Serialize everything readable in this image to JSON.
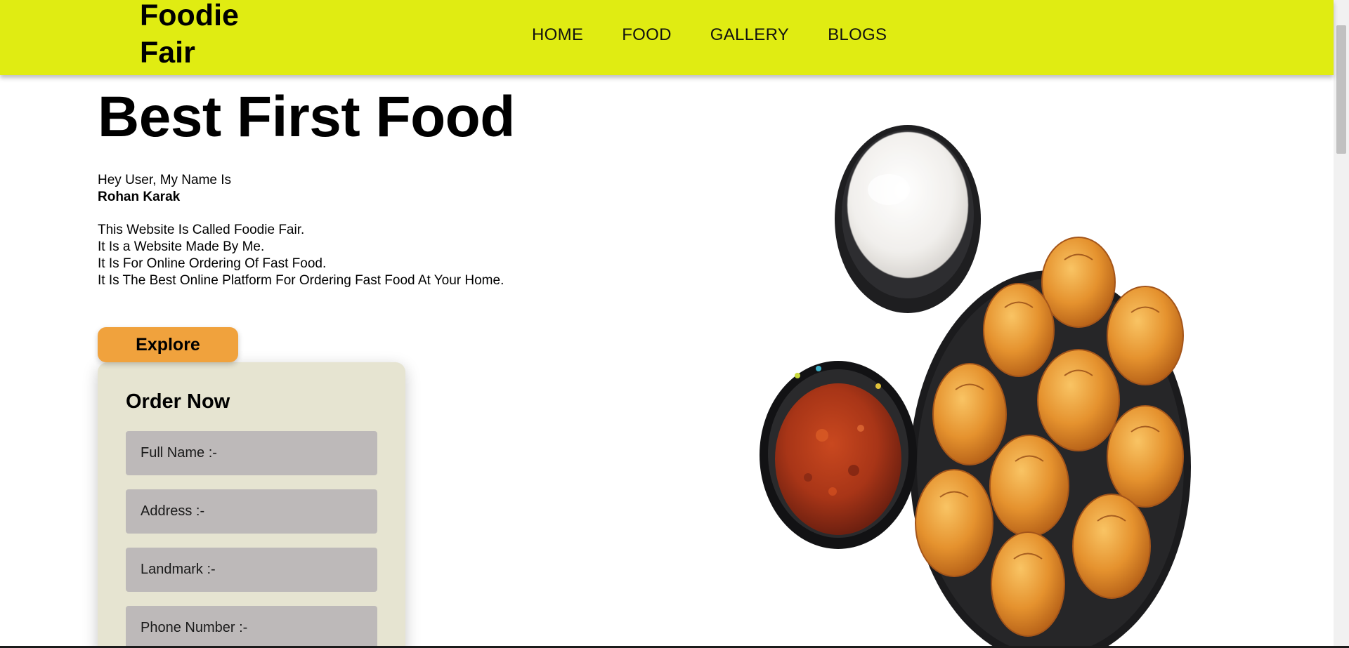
{
  "brand": {
    "name": "Foodie Fair"
  },
  "nav": {
    "items": [
      "HOME",
      "FOOD",
      "GALLERY",
      "BLOGS"
    ]
  },
  "hero": {
    "title": "Best First Food",
    "greeting": "Hey User, My Name Is",
    "author": "Rohan Karak",
    "description": [
      "This Website Is Called Foodie Fair.",
      "It Is a Website Made By Me.",
      "It Is For Online Ordering Of Fast Food.",
      "It Is The Best Online Platform For Ordering Fast Food At Your Home."
    ],
    "explore_label": "Explore"
  },
  "order": {
    "title": "Order Now",
    "fields": [
      {
        "placeholder": "Full Name :-",
        "value": ""
      },
      {
        "placeholder": "Address :-",
        "value": ""
      },
      {
        "placeholder": "Landmark :-",
        "value": ""
      },
      {
        "placeholder": "Phone Number :-",
        "value": ""
      }
    ]
  },
  "colors": {
    "navbar": "#e0ec12",
    "explore_button": "#f0a23d",
    "order_card": "#e6e4d1",
    "input_bg": "#bdb9b9"
  },
  "image": {
    "semantic": "momos-with-dips-image"
  }
}
